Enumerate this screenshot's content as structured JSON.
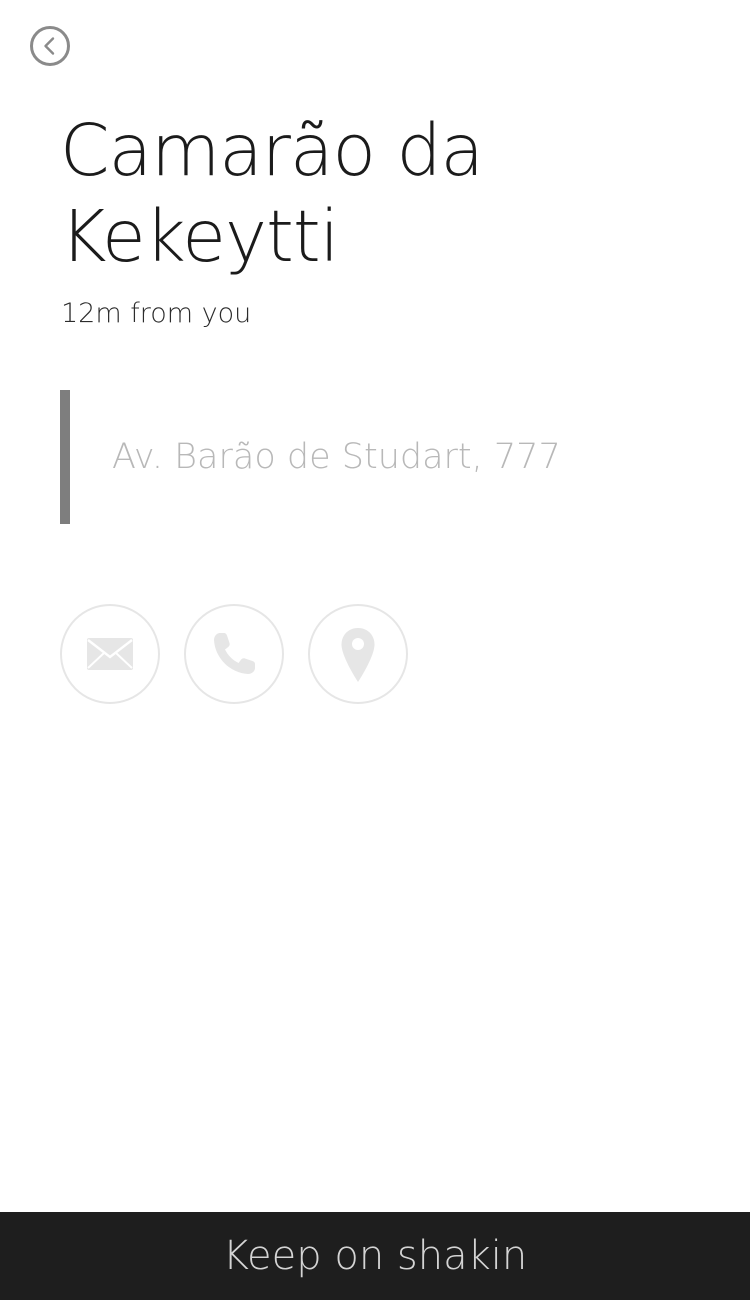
{
  "header": {
    "back_icon": "back-arrow-icon"
  },
  "place": {
    "name": "Camarão da Kekeytti",
    "distance": "12m from you",
    "address": "Av. Barão de Studart, 777"
  },
  "actions": {
    "email_icon": "envelope-icon",
    "phone_icon": "phone-icon",
    "map_icon": "map-pin-icon"
  },
  "footer": {
    "label": "Keep on shakin"
  },
  "colors": {
    "background": "#ffffff",
    "footer_background": "#1e1e1e",
    "footer_text": "#d4d4d4",
    "address_bar": "#7e7e7e",
    "icon_gray": "#e6e6e6"
  }
}
